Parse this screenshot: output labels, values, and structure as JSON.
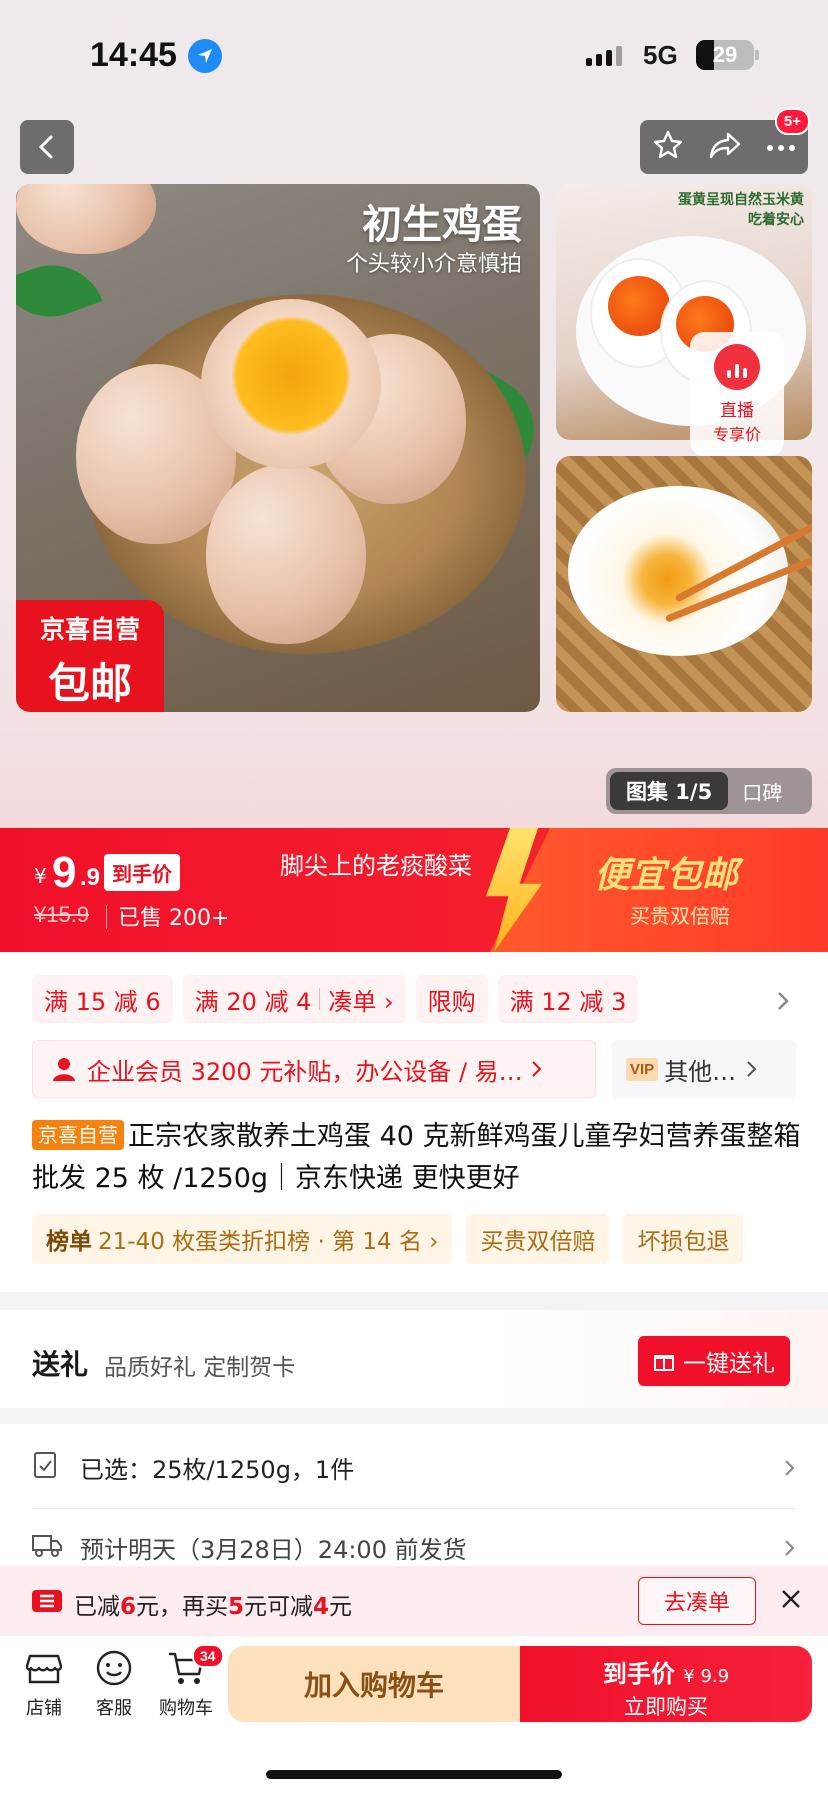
{
  "status_bar": {
    "time": "14:45",
    "network": "5G",
    "battery": "29"
  },
  "nav": {
    "more_badge": "5+"
  },
  "gallery": {
    "main_title": "初生鸡蛋",
    "main_subtitle": "个头较小介意慎拍",
    "tag_line1": "京喜自营",
    "tag_line2": "包邮",
    "side_caption_1": "蛋黄呈现自然玉米黄",
    "side_caption_2": "吃着安心",
    "live_label_1": "直播",
    "live_label_2": "专享价",
    "tab_active": "图集 1/5",
    "tab_inactive": "口碑"
  },
  "price": {
    "currency": "¥",
    "integer": "9",
    "decimal": ".9",
    "tag": "到手价",
    "original": "¥15.9",
    "sold": "已售 200+",
    "live_shop": "脚尖上的老痰酸菜",
    "banner_main": "便宜包邮",
    "banner_sub": "买贵双倍赔"
  },
  "coupons": [
    {
      "label": "满 15 减 6"
    },
    {
      "label": "满 20 减 4",
      "extra": "凑单 ›"
    },
    {
      "label": "限购"
    },
    {
      "label": "满 12 减 3"
    }
  ],
  "vip": {
    "text": "企业会员 3200 元补贴，办公设备 / 易…",
    "other_badge": "VIP",
    "other_text": "其他…"
  },
  "product": {
    "self_tag": "京喜自营",
    "title": "正宗农家散养土鸡蛋 40 克新鲜鸡蛋儿童孕妇营养蛋整箱批发 25 枚 /1250g｜京东快递 更快更好"
  },
  "ranks": [
    {
      "bold": "榜单",
      "text": "21-40 枚蛋类折扣榜 · 第 14 名 ›"
    },
    {
      "bold": "",
      "text": "买贵双倍赔"
    },
    {
      "bold": "",
      "text": "坏损包退"
    }
  ],
  "gift": {
    "title": "送礼",
    "subtitle": "品质好礼 定制贺卡",
    "button": "一键送礼"
  },
  "spec": {
    "selected": "已选：25枚/1250g，1件",
    "shipping": "预计明天（3月28日）24:00 前发货"
  },
  "promo": {
    "p1": "已减",
    "v1": "6",
    "p2": "元，再买",
    "v2": "5",
    "p3": "元可减",
    "v3": "4",
    "p4": "元",
    "button": "去凑单"
  },
  "bottom_bar": {
    "shop": "店铺",
    "service": "客服",
    "cart": "购物车",
    "cart_count": "34",
    "add_cart": "加入购物车",
    "buy_price_label": "到手价",
    "buy_price": "¥ 9.9",
    "buy_now": "立即购买"
  },
  "colors": {
    "brand_red": "#f0102a",
    "accent_orange": "#f5820f",
    "cart_bg": "#fde1bd"
  }
}
